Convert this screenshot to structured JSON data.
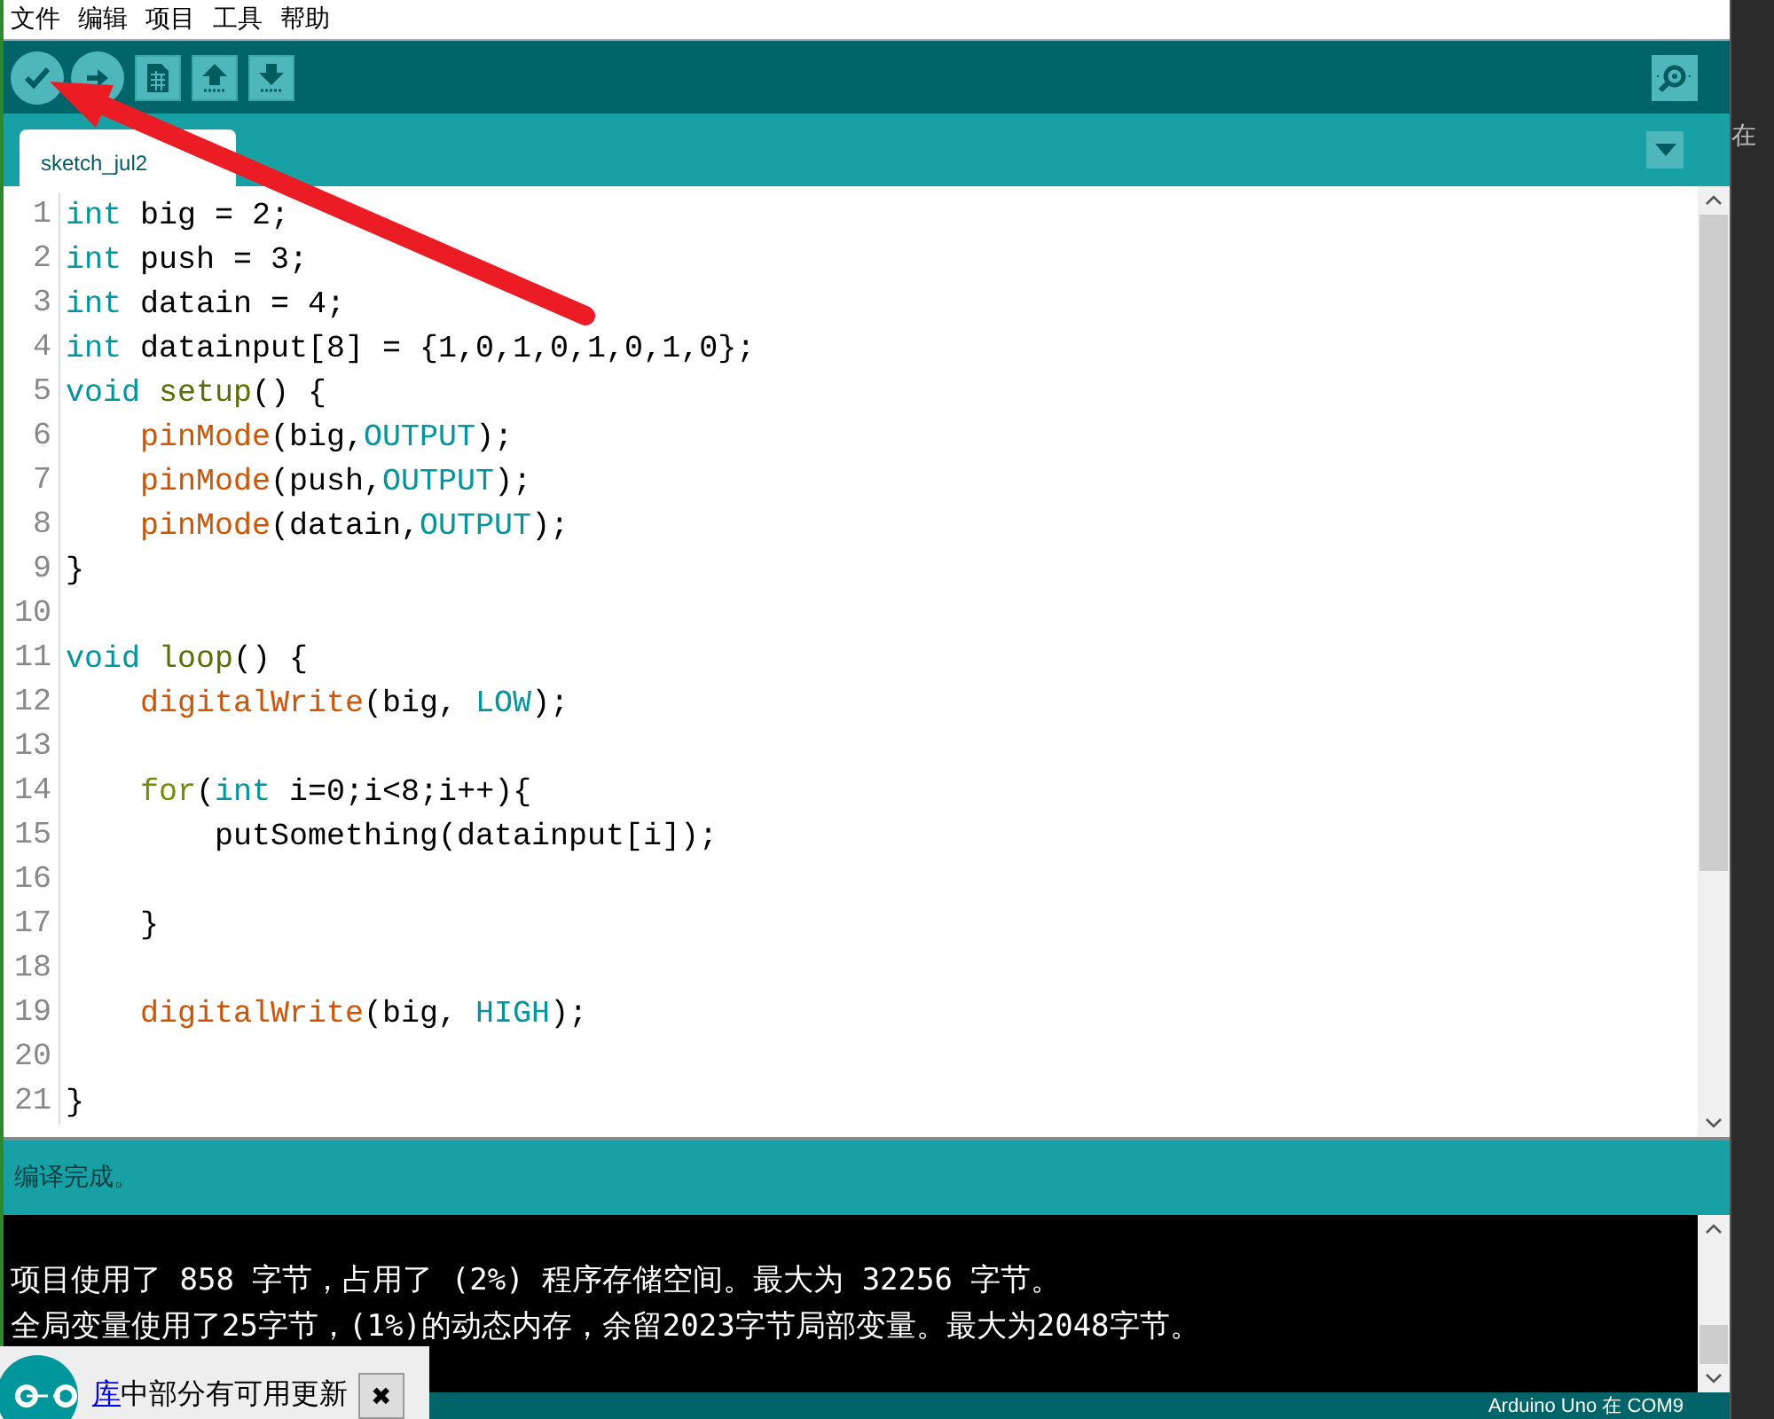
{
  "menu_bar": {
    "items": [
      "文件",
      "编辑",
      "项目",
      "工具",
      "帮助"
    ]
  },
  "toolbar": {
    "buttons": [
      {
        "kind": "verify"
      },
      {
        "kind": "upload"
      },
      {
        "kind": "new"
      },
      {
        "kind": "open"
      },
      {
        "kind": "save"
      }
    ],
    "right_button": {
      "kind": "serial-monitor"
    }
  },
  "tabs": [
    {
      "label": "sketch_jul2",
      "selected": true
    }
  ],
  "editor": {
    "lines": [
      {
        "number": "1",
        "tokens": [
          {
            "kind": "type",
            "text": "int"
          },
          {
            "kind": "plain",
            "text": " big = 2;"
          }
        ]
      },
      {
        "number": "2",
        "tokens": [
          {
            "kind": "type",
            "text": "int"
          },
          {
            "kind": "plain",
            "text": " push = 3;"
          }
        ]
      },
      {
        "number": "3",
        "tokens": [
          {
            "kind": "type",
            "text": "int"
          },
          {
            "kind": "plain",
            "text": " datain = 4;"
          }
        ]
      },
      {
        "number": "4",
        "tokens": [
          {
            "kind": "type",
            "text": "int"
          },
          {
            "kind": "plain",
            "text": " datainput[8] = {1,0,1,0,1,0,1,0};"
          }
        ]
      },
      {
        "number": "5",
        "tokens": [
          {
            "kind": "type",
            "text": "void "
          },
          {
            "kind": "structure",
            "text": "setup"
          },
          {
            "kind": "plain",
            "text": "() {"
          }
        ]
      },
      {
        "number": "6",
        "tokens": [
          {
            "kind": "function",
            "text": "    pinMode"
          },
          {
            "kind": "plain",
            "text": "(big,"
          },
          {
            "kind": "constant",
            "text": "OUTPUT"
          },
          {
            "kind": "plain",
            "text": ");"
          }
        ]
      },
      {
        "number": "7",
        "tokens": [
          {
            "kind": "function",
            "text": "    pinMode"
          },
          {
            "kind": "plain",
            "text": "(push,"
          },
          {
            "kind": "constant",
            "text": "OUTPUT"
          },
          {
            "kind": "plain",
            "text": ");"
          }
        ]
      },
      {
        "number": "8",
        "tokens": [
          {
            "kind": "function",
            "text": "    pinMode"
          },
          {
            "kind": "plain",
            "text": "(datain,"
          },
          {
            "kind": "constant",
            "text": "OUTPUT"
          },
          {
            "kind": "plain",
            "text": ");"
          }
        ]
      },
      {
        "number": "9",
        "tokens": [
          {
            "kind": "plain",
            "text": "}"
          }
        ]
      },
      {
        "number": "10"
      },
      {
        "number": "11",
        "tokens": [
          {
            "kind": "type",
            "text": "void "
          },
          {
            "kind": "structure",
            "text": "loop"
          },
          {
            "kind": "plain",
            "text": "() {"
          }
        ]
      },
      {
        "number": "12",
        "tokens": [
          {
            "kind": "function",
            "text": "    digitalWrite"
          },
          {
            "kind": "plain",
            "text": "(big, "
          },
          {
            "kind": "constant",
            "text": "LOW"
          },
          {
            "kind": "plain",
            "text": ");"
          }
        ]
      },
      {
        "number": "13"
      },
      {
        "number": "14",
        "tokens": [
          {
            "kind": "control",
            "text": "    for"
          },
          {
            "kind": "plain",
            "text": "("
          },
          {
            "kind": "type",
            "text": "int"
          },
          {
            "kind": "plain",
            "text": " i=0;i<8;i++){"
          }
        ]
      },
      {
        "number": "15",
        "tokens": [
          {
            "kind": "plain",
            "text": "        putSomething(datainput[i]);"
          }
        ]
      },
      {
        "number": "16"
      },
      {
        "number": "17",
        "tokens": [
          {
            "kind": "plain",
            "text": "    }"
          }
        ]
      },
      {
        "number": "18"
      },
      {
        "number": "19",
        "tokens": [
          {
            "kind": "function",
            "text": "    digitalWrite"
          },
          {
            "kind": "plain",
            "text": "(big, "
          },
          {
            "kind": "constant",
            "text": "HIGH"
          },
          {
            "kind": "plain",
            "text": ");"
          }
        ]
      },
      {
        "number": "20"
      },
      {
        "number": "21",
        "tokens": [
          {
            "kind": "plain",
            "text": "}"
          }
        ]
      }
    ]
  },
  "status": "编译完成。",
  "console": [
    "项目使用了 858 字节，占用了 (2%) 程序存储空间。最大为 32256 字节。",
    "全局变量使用了25字节，(1%)的动态内存，余留2023字节局部变量。最大为2048字节。"
  ],
  "status_bar": "Arduino Uno 在 COM9",
  "notification": {
    "link": "库",
    "text": "中部分有可用更新",
    "close": "✖"
  },
  "side_window": {
    "text": "在"
  }
}
